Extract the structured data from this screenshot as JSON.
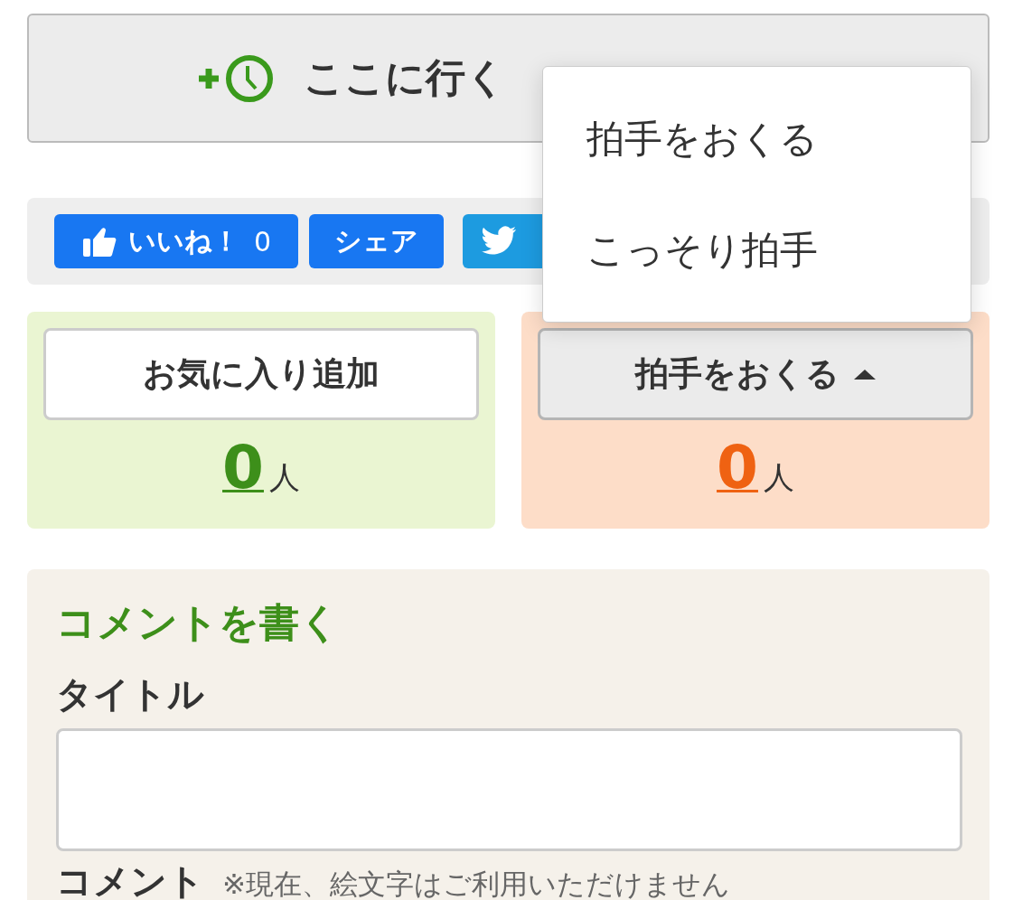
{
  "plan_button": {
    "label": "ここに行く"
  },
  "social": [
    {
      "kind": "like",
      "label": "いいね！",
      "count": "0"
    },
    {
      "kind": "share",
      "label": "シェア"
    },
    {
      "kind": "tweet"
    }
  ],
  "favorite": {
    "button": "お気に入り追加",
    "count": "0",
    "unit": "人"
  },
  "applause": {
    "button": "拍手をおくる",
    "expanded": true,
    "count": "0",
    "unit": "人",
    "menu": [
      "拍手をおくる",
      "こっそり拍手"
    ]
  },
  "comment_form": {
    "heading": "コメントを書く",
    "title_label": "タイトル",
    "comment_label": "コメント",
    "comment_note": "※現在、絵文字はご利用いただけません"
  }
}
